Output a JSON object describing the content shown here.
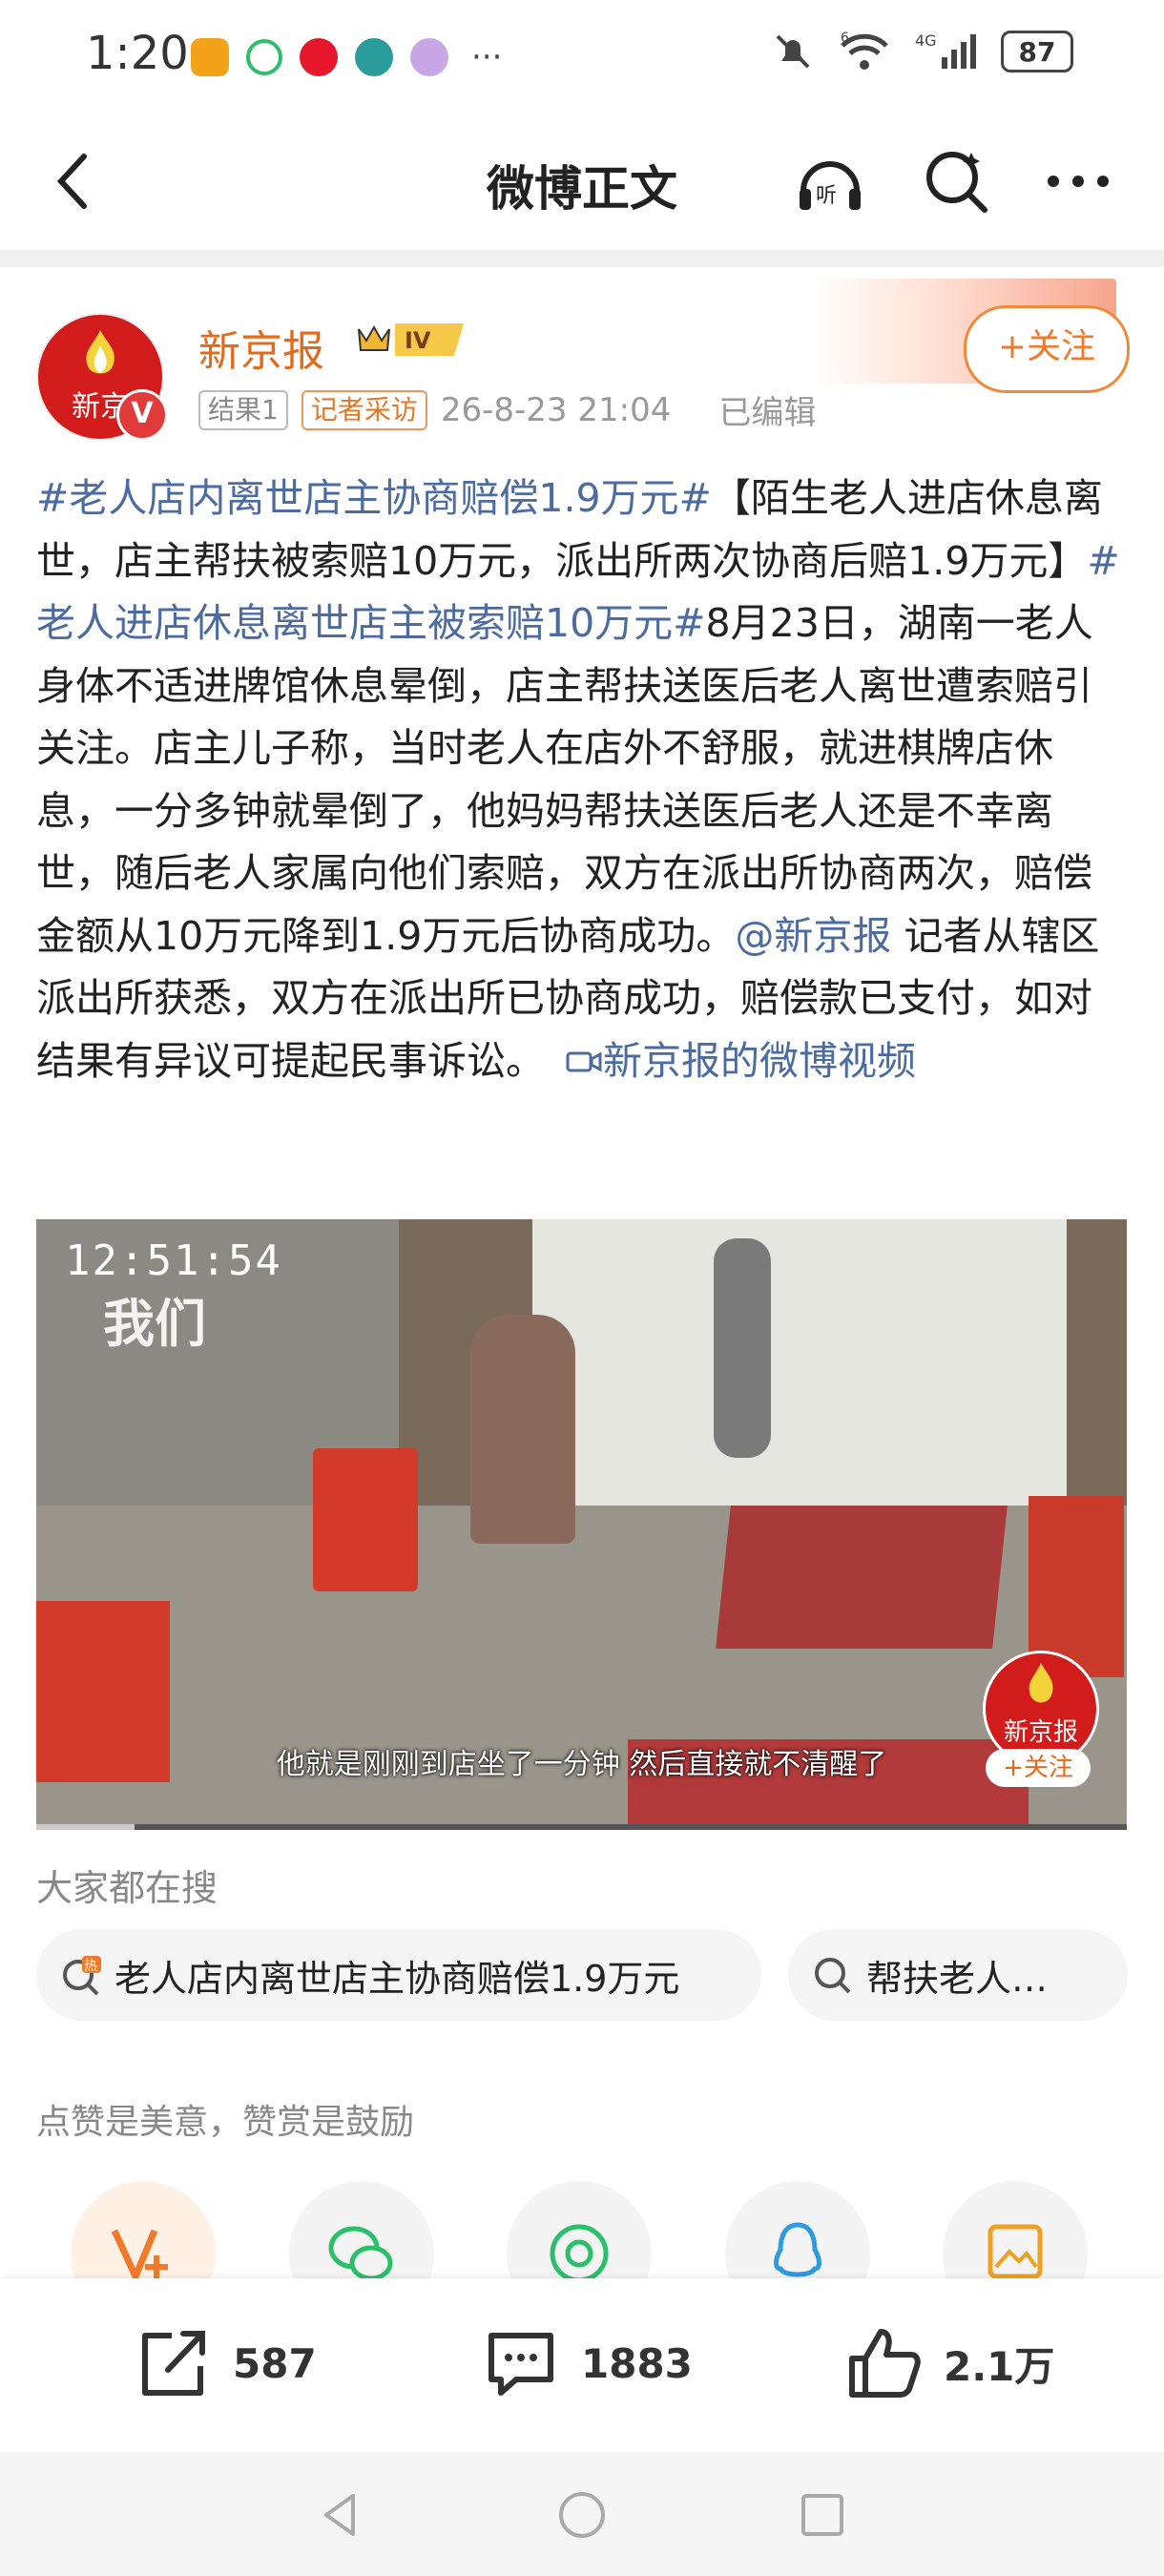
{
  "status_bar": {
    "time": "1:20",
    "more": "···",
    "signal_label": "4G",
    "wifi_label": "6",
    "battery": "87"
  },
  "header": {
    "title": "微博正文"
  },
  "author": {
    "name": "新京报",
    "avatar_text": "新京",
    "verified_badge": "V",
    "level_badge": "IV",
    "tag_result": "结果1",
    "tag_type": "记者采访",
    "timestamp": "26-8-23 21:04",
    "edited": "已编辑",
    "follow_label": "+关注"
  },
  "post": {
    "hashtag1": "#老人店内离世店主协商赔偿1.9万元#",
    "text1": "【陌生老人进店休息离世，店主帮扶被索赔10万元，派出所两次协商后赔1.9万元】",
    "hashtag2": "#老人进店休息离世店主被索赔10万元#",
    "text2": "8月23日，湖南一老人身体不适进牌馆休息晕倒，店主帮扶送医后老人离世遭索赔引关注。店主儿子称，当时老人在店外不舒服，就进棋牌店休息，一分多钟就晕倒了，他妈妈帮扶送医后老人还是不幸离世，随后老人家属向他们索赔，双方在派出所协商两次，赔偿金额从10万元降到1.9万元后协商成功。",
    "mention": "@新京报",
    "text3": " 记者从辖区派出所获悉，双方在派出所已协商成功，赔偿款已支付，如对结果有异议可提起民事诉讼。",
    "video_link": "新京报的微博视频"
  },
  "video": {
    "timestamp_overlay": "12:51:54",
    "watermark": "我们",
    "subtitle": "他就是刚刚到店坐了一分钟 然后直接就不清醒了",
    "logo_text": "新京报",
    "follow_label": "+关注",
    "progress": 0.09
  },
  "search": {
    "heading": "大家都在搜",
    "chips": [
      {
        "label": "老人店内离世店主协商赔偿1.9万元",
        "badge": "热"
      },
      {
        "label": "帮扶老人…"
      }
    ]
  },
  "like_note": "点赞是美意，赞赏是鼓励",
  "actions": {
    "repost": "587",
    "comments": "1883",
    "likes": "2.1万"
  },
  "colors": {
    "link": "#4c6ba0",
    "accent_orange": "#f07a2a",
    "brand_red": "#d21b1b"
  }
}
